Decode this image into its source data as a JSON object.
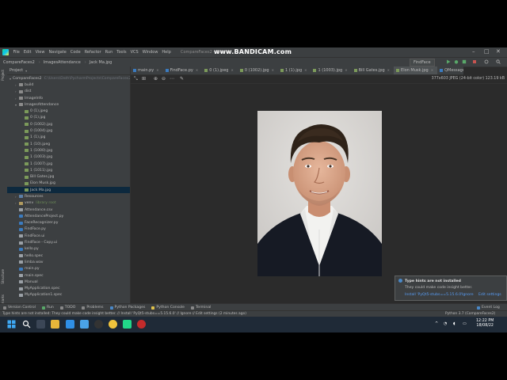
{
  "menu": {
    "items": [
      "File",
      "Edit",
      "View",
      "Navigate",
      "Code",
      "Refactor",
      "Run",
      "Tools",
      "VCS",
      "Window",
      "Help"
    ],
    "window_title": "CompareFaces2 - Elon M",
    "recorder_watermark": "www.BANDICAM.com"
  },
  "navbar": {
    "breadcrumbs": [
      "CompareFaces2",
      "ImagesAttendance",
      "Jack Ma.jpg"
    ],
    "run_config": "FindFace"
  },
  "toolstripe": {
    "project_label": "Project",
    "structure_label": "Structure",
    "bookmarks_label": "Bookmarks"
  },
  "project_panel": {
    "title": "Project",
    "tree": [
      {
        "label": "CompareFaces2",
        "hint": "C:\\Users\\Dath\\PycharmProjects\\CompareFaces2",
        "indent": 0,
        "type": "folder",
        "arrow": "▾"
      },
      {
        "label": "build",
        "indent": 1,
        "type": "folder",
        "arrow": "›"
      },
      {
        "label": "dist",
        "indent": 1,
        "type": "folder",
        "arrow": "›"
      },
      {
        "label": "ImageInfo",
        "indent": 1,
        "type": "folder",
        "arrow": "›"
      },
      {
        "label": "ImagesAttendance",
        "indent": 1,
        "type": "folder",
        "arrow": "▾"
      },
      {
        "label": "0 (1).jpeg",
        "indent": 2,
        "type": "img"
      },
      {
        "label": "0 (1).jpg",
        "indent": 2,
        "type": "img"
      },
      {
        "label": "0 (1002).jpg",
        "indent": 2,
        "type": "img"
      },
      {
        "label": "0 (1004).jpg",
        "indent": 2,
        "type": "img"
      },
      {
        "label": "1 (1).jpg",
        "indent": 2,
        "type": "img"
      },
      {
        "label": "1 (10).jpeg",
        "indent": 2,
        "type": "img"
      },
      {
        "label": "1 (1000).jpg",
        "indent": 2,
        "type": "img"
      },
      {
        "label": "1 (1003).jpg",
        "indent": 2,
        "type": "img"
      },
      {
        "label": "1 (1007).jpg",
        "indent": 2,
        "type": "img"
      },
      {
        "label": "1 (1011).jpg",
        "indent": 2,
        "type": "img"
      },
      {
        "label": "Bill Gates.jpg",
        "indent": 2,
        "type": "img"
      },
      {
        "label": "Elon Musk.jpg",
        "indent": 2,
        "type": "img"
      },
      {
        "label": "Jack Ma.jpg",
        "indent": 2,
        "type": "img",
        "selected": true
      },
      {
        "label": "Resources",
        "indent": 1,
        "type": "folder",
        "arrow": "›"
      },
      {
        "label": "venv",
        "hint": "library root",
        "indent": 1,
        "type": "folder",
        "arrow": "›"
      },
      {
        "label": "Attendance.csv",
        "indent": 1,
        "type": "gen"
      },
      {
        "label": "AttendanceProject.py",
        "indent": 1,
        "type": "py"
      },
      {
        "label": "FaceRecognizer.py",
        "indent": 1,
        "type": "py"
      },
      {
        "label": "FindFace.py",
        "indent": 1,
        "type": "py"
      },
      {
        "label": "FindFace.ui",
        "indent": 1,
        "type": "gen"
      },
      {
        "label": "FindFace - Copy.ui",
        "indent": 1,
        "type": "gen"
      },
      {
        "label": "kello.py",
        "indent": 1,
        "type": "py"
      },
      {
        "label": "hello.spec",
        "indent": 1,
        "type": "gen"
      },
      {
        "label": "limba.wav",
        "indent": 1,
        "type": "gen"
      },
      {
        "label": "main.py",
        "indent": 1,
        "type": "py"
      },
      {
        "label": "main.spec",
        "indent": 1,
        "type": "gen"
      },
      {
        "label": "Manual",
        "indent": 1,
        "type": "gen"
      },
      {
        "label": "MyApplication.spec",
        "indent": 1,
        "type": "gen"
      },
      {
        "label": "MyApplication1.spec",
        "indent": 1,
        "type": "gen"
      }
    ]
  },
  "editor": {
    "tabs": [
      {
        "label": "main.py",
        "type": "py"
      },
      {
        "label": "FindFace.py",
        "type": "py"
      },
      {
        "label": "0 (1).jpeg",
        "type": "img"
      },
      {
        "label": "0 (1002).jpg",
        "type": "img"
      },
      {
        "label": "1 (1).jpg",
        "type": "img"
      },
      {
        "label": "1 (1003).jpg",
        "type": "img"
      },
      {
        "label": "Bill Gates.jpg",
        "type": "img"
      },
      {
        "label": "Elon Musk.jpg",
        "type": "img",
        "active": true
      },
      {
        "label": "QMessageBox.py",
        "type": "py"
      }
    ],
    "image_info": "377x603 JPEG (24-bit color) 123.19 kB"
  },
  "notification": {
    "title": "Type hints are not installed",
    "body": "They could make code insight better.",
    "action_install": "Install 'PyQt5-stubs==5.15.6.0'",
    "action_ignore": "Ignore",
    "action_settings": "Edit settings"
  },
  "bottom_tabs": [
    "Version Control",
    "Run",
    "TODO",
    "Problems",
    "Python Packages",
    "Python Console",
    "Terminal"
  ],
  "event_log": "Event Log",
  "status": {
    "message": "Type hints are not installed: They could make code insight better. // Install 'PyQt5-stubs==5.15.6.0' // Ignore // Edit settings (2 minutes ago)",
    "interpreter": "Python 3.7 (CompareFaces2)"
  },
  "taskbar": {
    "time": "12:22 PM",
    "date": "18/08/22"
  },
  "colors": {
    "ide_bg": "#2b2b2b",
    "panel": "#3c3f41",
    "selection": "#0d293e",
    "accent": "#4a88c7",
    "taskbar": "#1f2a37"
  }
}
